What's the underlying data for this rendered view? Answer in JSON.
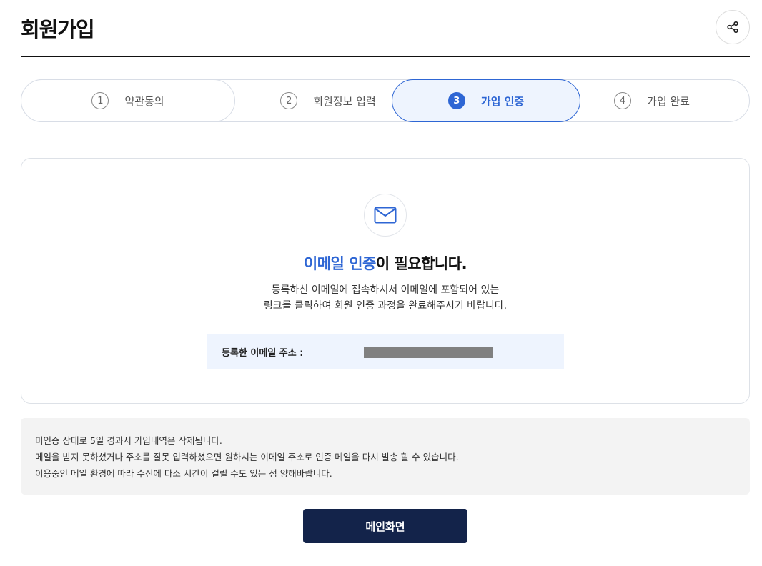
{
  "header": {
    "title": "회원가입",
    "share_icon": "share-icon"
  },
  "steps": [
    {
      "num": "1",
      "label": "약관동의",
      "active": false
    },
    {
      "num": "2",
      "label": "회원정보 입력",
      "active": false
    },
    {
      "num": "3",
      "label": "가입 인증",
      "active": true
    },
    {
      "num": "4",
      "label": "가입 완료",
      "active": false
    }
  ],
  "verify": {
    "icon": "mail-icon",
    "title_highlight": "이메일 인증",
    "title_rest": "이 필요합니다.",
    "desc_line1": "등록하신 이메일에 접속하셔서 이메일에 포함되어 있는",
    "desc_line2": "링크를 클릭하여 회원 인증 과정을 완료해주시기 바랍니다.",
    "email_label": "등록한 이메일 주소 :"
  },
  "notice": {
    "line1": "미인증 상태로 5일 경과시 가입내역은 삭제됩니다.",
    "line2": "메일을 받지 못하셨거나 주소를 잘못 입력하셨으면 원하시는 이메일 주소로 인증 메일을 다시 발송 할 수 있습니다.",
    "line3": "이용중인 메일 환경에 따라 수신에 다소 시간이 걸릴 수도 있는 점 양해바랍니다."
  },
  "main_button": "메인화면",
  "colors": {
    "accent": "#2e66d4",
    "button_bg": "#13234a",
    "step_active_bg": "#eef4fe",
    "notice_bg": "#f3f3f3"
  }
}
